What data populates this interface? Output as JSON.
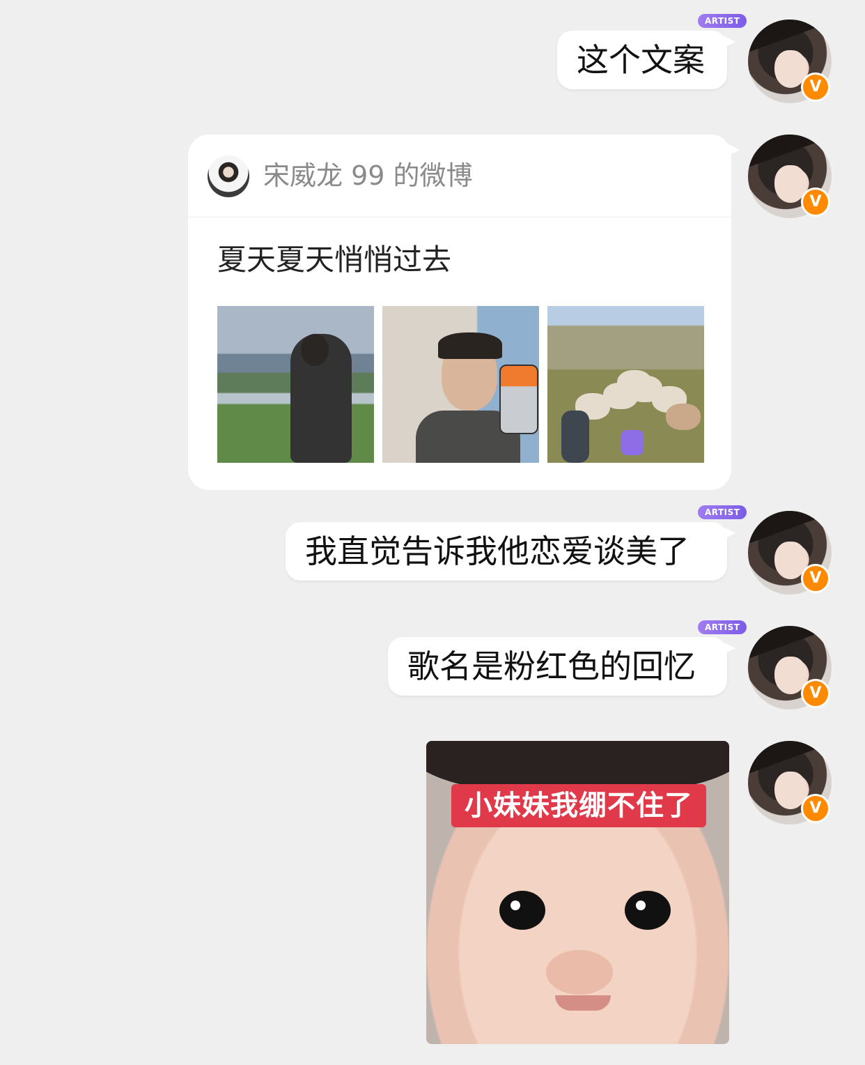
{
  "messages": [
    {
      "type": "text",
      "text": "这个文案",
      "tag": "ARTIST"
    },
    {
      "type": "weibo_card",
      "author": "宋威龙 99 的微博",
      "content": "夏天夏天悄悄过去",
      "images": [
        "photo-riverside",
        "photo-mirror-selfie",
        "photo-sheep-field"
      ]
    },
    {
      "type": "text",
      "text": "我直觉告诉我他恋爱谈美了",
      "tag": "ARTIST"
    },
    {
      "type": "text",
      "text": "歌名是粉红色的回忆",
      "tag": "ARTIST"
    },
    {
      "type": "sticker",
      "caption": "小妹妹我绷不住了"
    }
  ],
  "avatar_badge": "V",
  "colors": {
    "background": "#efefef",
    "bubble": "#ffffff",
    "badge": "#ff8a00",
    "artist_tag": "#7b5ce8",
    "sticker_banner": "#e0394a"
  }
}
